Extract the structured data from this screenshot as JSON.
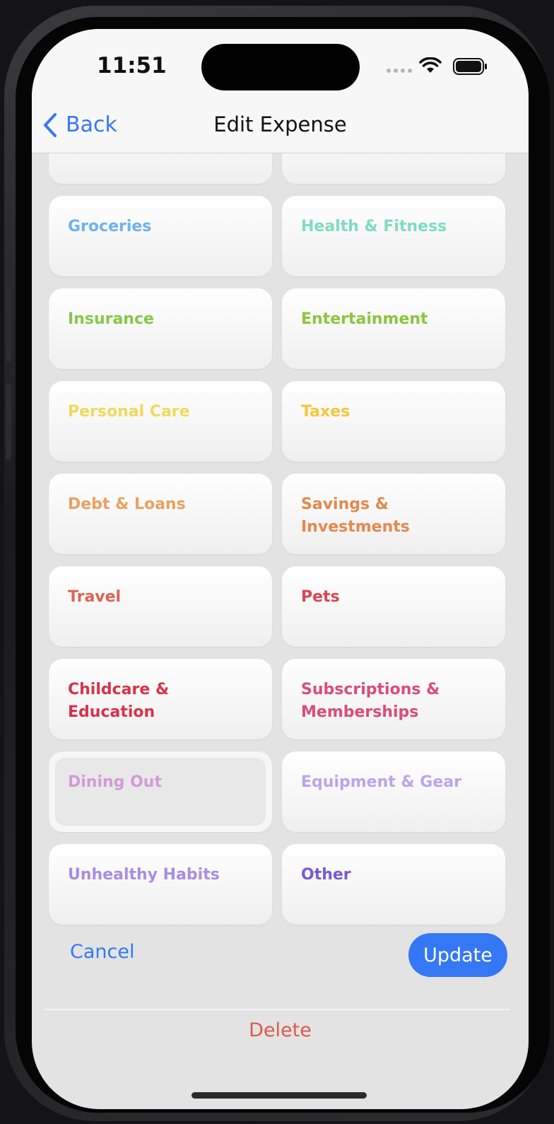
{
  "status_bar": {
    "time": "11:51"
  },
  "nav": {
    "back_label": "Back",
    "title": "Edit Expense"
  },
  "categories": [
    {
      "label": "",
      "color": "#6fb2ee"
    },
    {
      "label": "",
      "color": "#7fdcc4"
    },
    {
      "label": "Groceries",
      "color": "#6fb2ee"
    },
    {
      "label": "Health & Fitness",
      "color": "#7fdcc4"
    },
    {
      "label": "Insurance",
      "color": "#86c84b"
    },
    {
      "label": "Entertainment",
      "color": "#8cc63e"
    },
    {
      "label": "Personal Care",
      "color": "#f0da5c"
    },
    {
      "label": "Taxes",
      "color": "#f3c839"
    },
    {
      "label": "Debt & Loans",
      "color": "#eba15f"
    },
    {
      "label": "Savings & Investments",
      "color": "#e3894e"
    },
    {
      "label": "Travel",
      "color": "#de6456"
    },
    {
      "label": "Pets",
      "color": "#d94654"
    },
    {
      "label": "Childcare & Education",
      "color": "#d7334b"
    },
    {
      "label": "Subscriptions & Memberships",
      "color": "#d94d76"
    },
    {
      "label": "Dining Out",
      "color": "#d39ad8",
      "selected": true
    },
    {
      "label": "Equipment & Gear",
      "color": "#bba5ec"
    },
    {
      "label": "Unhealthy Habits",
      "color": "#a98ee0"
    },
    {
      "label": "Other",
      "color": "#7a5ad3"
    }
  ],
  "actions": {
    "cancel_label": "Cancel",
    "update_label": "Update",
    "delete_label": "Delete"
  },
  "colors": {
    "accent": "#3478f6",
    "destructive": "#dd5a4a"
  }
}
